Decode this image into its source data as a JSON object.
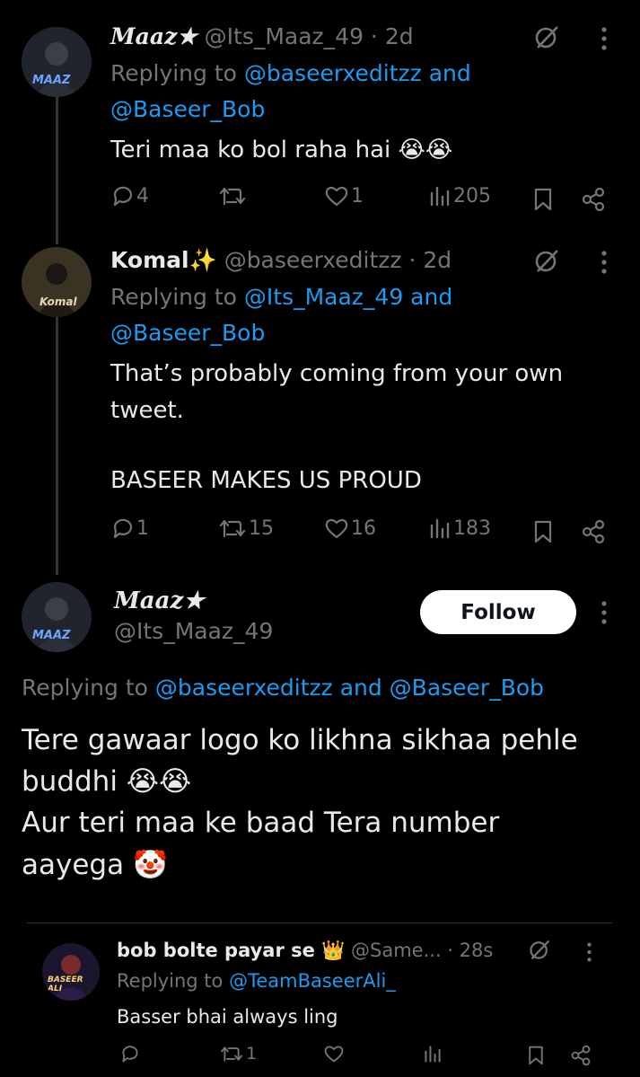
{
  "colors": {
    "background": "#000000",
    "text": "#e7e9ea",
    "muted": "#71767b",
    "link": "#1d9bf0"
  },
  "tweets": [
    {
      "name": "Maaz★",
      "handle": "@Its_Maaz_49 · 2d",
      "replying_prefix": "Replying to ",
      "replying_line1": "@baseerxeditzz and",
      "replying_line2": "@Baseer_Bob",
      "text": "Teri maa ko bol raha hai 😭😭",
      "replies": "4",
      "retweets": "",
      "likes": "1",
      "views": "205",
      "avatar_text": "MAAZ"
    },
    {
      "name": "Komal✨",
      "handle": "@baseerxeditzz · 2d",
      "replying_prefix": "Replying to ",
      "replying_line1": "@Its_Maaz_49 and",
      "replying_line2": "@Baseer_Bob",
      "text_line1": "That’s probably coming from your own",
      "text_line2": "tweet.",
      "text_line3": "BASEER MAKES US PROUD",
      "replies": "1",
      "retweets": "15",
      "likes": "16",
      "views": "183",
      "avatar_text": "Komal"
    }
  ],
  "main": {
    "name": "Maaz★",
    "handle": "@Its_Maaz_49",
    "follow_label": "Follow",
    "replying_prefix": "Replying to ",
    "replying_users": "@baseerxeditzz and @Baseer_Bob",
    "text_line1": "Tere gawaar logo ko likhna sikhaa pehle",
    "text_line2": "buddhi 😭😭",
    "text_line3": "Aur teri maa ke baad Tera number",
    "text_line4": "aayega 🤡",
    "avatar_text": "MAAZ"
  },
  "quoted": {
    "name": "bob bolte payar se 👑",
    "handle": "@Same...",
    "time": "· 28s",
    "replying_prefix": "Replying to ",
    "replying_user": "@TeamBaseerAli_",
    "text": "Basser bhai always ling",
    "retweets": "1",
    "avatar_text": "BASEER ALI"
  }
}
